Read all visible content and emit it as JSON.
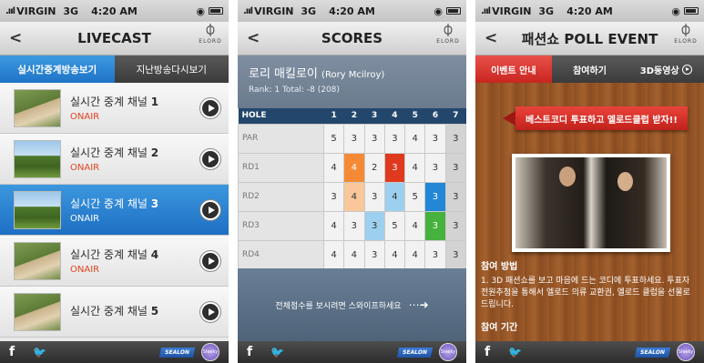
{
  "status": {
    "carrier": "VIRGIN",
    "network": "3G",
    "time": "4:20 AM"
  },
  "footer": {
    "facebook": "f",
    "sealon": "SEALON",
    "badge": "Sleeky"
  },
  "elord": {
    "mark": "⏀",
    "text": "ELORD"
  },
  "livecast": {
    "title": "LIVECAST",
    "tabs": [
      "실시간중계방송보기",
      "지난방송다시보기"
    ],
    "channels": [
      {
        "prefix": "실시간 중계 채널",
        "num": "1",
        "state": "ONAIR"
      },
      {
        "prefix": "실시간 중계 채널",
        "num": "2",
        "state": "ONAIR"
      },
      {
        "prefix": "실시간 중계 채널",
        "num": "3",
        "state": "ONAIR"
      },
      {
        "prefix": "실시간 중계 채널",
        "num": "4",
        "state": "ONAIR"
      },
      {
        "prefix": "실시간 중계 채널",
        "num": "5",
        "state": ""
      }
    ]
  },
  "scores": {
    "title": "SCORES",
    "player_kr": "로리 매킬로이",
    "player_en": "(Rory Mcilroy)",
    "rank_total": "Rank: 1   Total: -8 (208)",
    "hole_label": "HOLE",
    "holes": [
      "1",
      "2",
      "3",
      "4",
      "5",
      "6",
      "7"
    ],
    "rows": [
      {
        "label": "PAR",
        "values": [
          "5",
          "3",
          "3",
          "3",
          "4",
          "3",
          "3"
        ]
      },
      {
        "label": "RD1",
        "values": [
          "4",
          "4",
          "2",
          "3",
          "4",
          "3",
          "3"
        ]
      },
      {
        "label": "RD2",
        "values": [
          "3",
          "4",
          "3",
          "4",
          "5",
          "3",
          "3"
        ]
      },
      {
        "label": "RD3",
        "values": [
          "4",
          "3",
          "3",
          "5",
          "4",
          "3",
          "3"
        ]
      },
      {
        "label": "RD4",
        "values": [
          "4",
          "4",
          "3",
          "4",
          "4",
          "3",
          "3"
        ]
      }
    ],
    "swipe_text": "전체점수를 보시려면 스와이프하세요"
  },
  "poll": {
    "title": "패션쇼 POLL EVENT",
    "tabs": [
      "이벤트 안내",
      "참여하기",
      "3D동영상"
    ],
    "ribbon": "베스트코디 투표하고 엘로드클럽 받자!!",
    "how_title": "참여 방법",
    "how_text": "1. 3D 패션쇼를 보고 마음에 드는 코디에 투표하세요. 투표자 전원추첨을 통해서 엘로드 의류 교환권, 엘로드 클럽을 선물로 드립니다.",
    "period_title": "참여 기간"
  }
}
